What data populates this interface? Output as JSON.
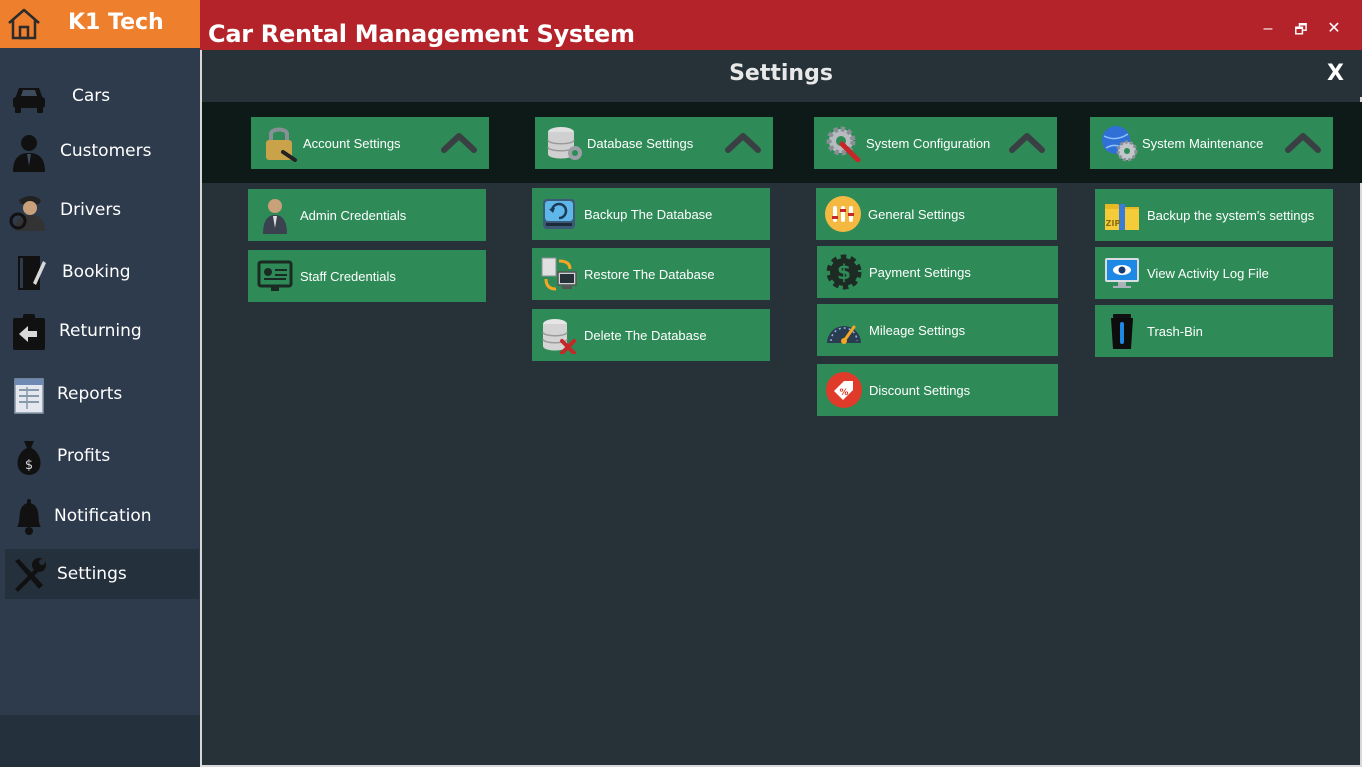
{
  "brand": {
    "name": "K1 Tech"
  },
  "window": {
    "title": "Car Rental Management System",
    "minimize": "‒",
    "restore": "🗗",
    "close": "✕"
  },
  "sidebar": {
    "items": [
      {
        "label": "Cars"
      },
      {
        "label": "Customers"
      },
      {
        "label": "Drivers"
      },
      {
        "label": "Booking"
      },
      {
        "label": "Returning"
      },
      {
        "label": "Reports"
      },
      {
        "label": "Profits"
      },
      {
        "label": "Notification"
      },
      {
        "label": "Settings",
        "active": true
      }
    ]
  },
  "page": {
    "title": "Settings",
    "close": "X"
  },
  "columns": [
    {
      "header": "Account Settings",
      "items": [
        "Admin Credentials",
        "Staff Credentials"
      ]
    },
    {
      "header": "Database Settings",
      "items": [
        "Backup The Database",
        "Restore The Database",
        "Delete The Database"
      ]
    },
    {
      "header": "System Configuration",
      "items": [
        "General Settings",
        "Payment Settings",
        "Mileage Settings",
        "Discount Settings"
      ]
    },
    {
      "header": "System Maintenance",
      "items": [
        "Backup the system's settings",
        "View Activity Log File",
        "Trash-Bin"
      ]
    }
  ],
  "colors": {
    "titlebar": "#b5232a",
    "brand": "#ee7f2d",
    "sidebar": "#2e3b4c",
    "button": "#2e8b57",
    "background": "#263238"
  }
}
